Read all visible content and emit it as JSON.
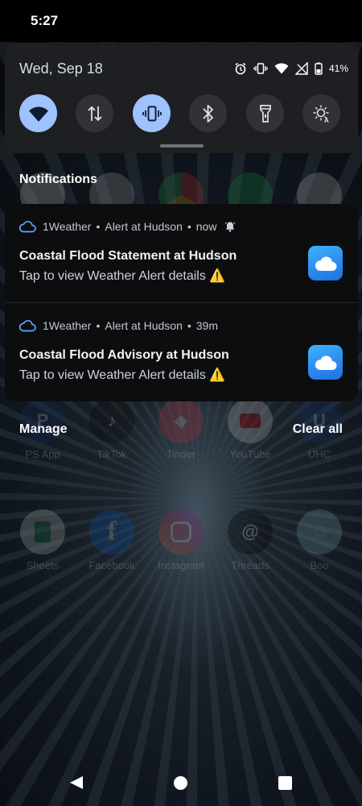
{
  "status_bar": {
    "time": "5:27"
  },
  "quick_settings": {
    "date": "Wed, Sep 18",
    "battery_percent": "41%",
    "status_icons": [
      "alarm-icon",
      "vibrate-icon",
      "wifi-icon",
      "signal-icon",
      "battery-icon"
    ],
    "tiles": [
      {
        "name": "wifi",
        "active": true
      },
      {
        "name": "data-transfer",
        "active": false
      },
      {
        "name": "vibrate",
        "active": true
      },
      {
        "name": "bluetooth",
        "active": false
      },
      {
        "name": "flashlight",
        "active": false
      },
      {
        "name": "auto-brightness",
        "active": false
      }
    ]
  },
  "notifications_header": "Notifications",
  "notifications": [
    {
      "app": "1Weather",
      "subtext": "Alert at Hudson",
      "time": "now",
      "has_bell": true,
      "title": "Coastal Flood Statement at Hudson",
      "body": "Tap to view Weather Alert details ⚠️"
    },
    {
      "app": "1Weather",
      "subtext": "Alert at Hudson",
      "time": "39m",
      "has_bell": false,
      "title": "Coastal Flood Advisory at Hudson",
      "body": "Tap to view Weather Alert details ⚠️"
    }
  ],
  "actions": {
    "manage": "Manage",
    "clear_all": "Clear all"
  },
  "background_apps": {
    "row1": [
      "PS App",
      "TikTok",
      "Tinder",
      "YouTube",
      "UHC"
    ],
    "row2": [
      "Sheets",
      "Facebook",
      "Instagram",
      "Threads",
      "Boo"
    ]
  },
  "colors": {
    "tile_active": "#9ec1ff",
    "tile_inactive": "#303236",
    "panel": "#1d1f22",
    "card": "#0c0d0f",
    "weather_icon": "#2a8cf5"
  }
}
